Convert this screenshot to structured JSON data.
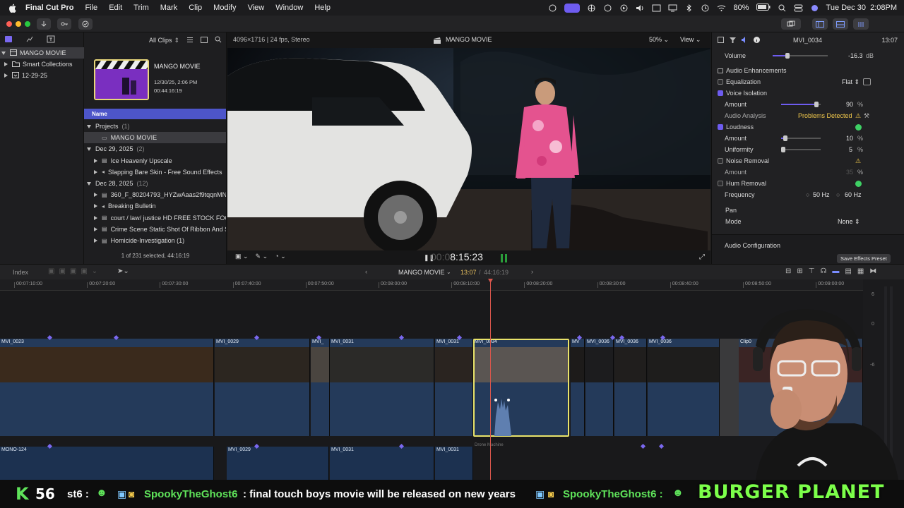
{
  "menubar": {
    "app_name": "Final Cut Pro",
    "items": [
      "File",
      "Edit",
      "Trim",
      "Mark",
      "Clip",
      "Modify",
      "View",
      "Window",
      "Help"
    ],
    "battery": "80%",
    "datetime": "Tue Dec 30  2:08PM"
  },
  "library": {
    "name": "MANGO MOVIE",
    "items": [
      "Smart Collections",
      "12-29-25"
    ]
  },
  "browser": {
    "filter": "All Clips",
    "project_card": {
      "title": "MANGO MOVIE",
      "date": "12/30/25, 2:06 PM",
      "duration": "00:44:16:19"
    },
    "column_header": "Name",
    "rows": [
      {
        "label": "Projects",
        "count": "(1)",
        "level": 0,
        "kind": "group"
      },
      {
        "label": "MANGO MOVIE",
        "level": 1,
        "kind": "project",
        "selected": true
      },
      {
        "label": "Dec 29, 2025",
        "count": "(2)",
        "level": 0,
        "kind": "group"
      },
      {
        "label": "Ice Heavenly Upscale",
        "level": 1,
        "kind": "video"
      },
      {
        "label": "Slapping Bare Skin - Free Sound Effects",
        "level": 1,
        "kind": "audio"
      },
      {
        "label": "Dec 28, 2025",
        "count": "(12)",
        "level": 0,
        "kind": "group"
      },
      {
        "label": "360_F_80204793_HYZwAaas2f9tqqnMN",
        "level": 1,
        "kind": "video"
      },
      {
        "label": "Breaking Bulletin",
        "level": 1,
        "kind": "audio"
      },
      {
        "label": "court / law/ justice HD FREE STOCK FOO",
        "level": 1,
        "kind": "video"
      },
      {
        "label": "Crime Scene Static Shot Of Ribbon And S",
        "level": 1,
        "kind": "video"
      },
      {
        "label": "Homicide-Investigation (1)",
        "level": 1,
        "kind": "video"
      }
    ],
    "status": "1 of 231 selected, 44:16:19"
  },
  "viewer": {
    "format": "4096×1716 | 24 fps, Stereo",
    "title": "MANGO MOVIE",
    "zoom": "50%",
    "view_label": "View",
    "timecode_dim": "00:0",
    "timecode": "8:15:23"
  },
  "inspector": {
    "clip_name": "MVI_0034",
    "duration": "13:07",
    "volume_label": "Volume",
    "volume_value": "-16.3",
    "volume_unit": "dB",
    "section": "Audio Enhancements",
    "equalization": {
      "label": "Equalization",
      "value": "Flat"
    },
    "voice_isolation": {
      "label": "Voice Isolation",
      "checked": true,
      "amount_label": "Amount",
      "amount": "90",
      "unit": "%",
      "level": 0.9
    },
    "analysis": {
      "label": "Audio Analysis",
      "value": "Problems Detected"
    },
    "loudness": {
      "label": "Loudness",
      "checked": true,
      "amount_label": "Amount",
      "amount": "10",
      "unit": "%",
      "amount_level": 0.1,
      "uniformity_label": "Uniformity",
      "uniformity": "5",
      "uniformity_level": 0.05
    },
    "noise_removal": {
      "label": "Noise Removal",
      "checked": false,
      "amount_label": "Amount",
      "amount": "35",
      "unit": "%"
    },
    "hum_removal": {
      "label": "Hum Removal",
      "checked": false,
      "frequency_label": "Frequency",
      "opt1": "50 Hz",
      "opt2": "60 Hz"
    },
    "pan": {
      "label": "Pan",
      "mode_label": "Mode",
      "mode_value": "None"
    },
    "footer": "Audio Configuration",
    "save_button": "Save Effects Preset"
  },
  "timeline": {
    "index_label": "Index",
    "project": "MANGO MOVIE",
    "position": "13:07",
    "total": "44:16:19",
    "ruler": [
      "00:07:10:00",
      "00:07:20:00",
      "00:07:30:00",
      "00:07:40:00",
      "00:07:50:00",
      "00:08:00:00",
      "00:08:10:00",
      "00:08:20:00",
      "00:08:30:00",
      "00:08:40:00",
      "00:08:50:00",
      "00:09:00:00"
    ],
    "meter_labels": [
      "6",
      "0",
      "-6"
    ],
    "clips": [
      "MVI_0023",
      "MVI_0029",
      "MVI_",
      "MVI_0031",
      "MVI_0031",
      "MVI_0034",
      "MV",
      "MVI_0036",
      "MVI_0036",
      "MVI_0036",
      "Clip0"
    ],
    "lower_clips": [
      "MONO-124",
      "MVI_0029",
      "MVI_0031",
      "MVI_0031"
    ],
    "lower_label": "Drone Machine"
  },
  "ticker": {
    "count": "56",
    "chat1_tail": "st6 :",
    "chat2_user": "SpookyTheGhost6",
    "chat2_msg": ": final touch boys movie will be released on new years",
    "chat3_user": "SpookyTheGhost6 :",
    "banner": "BURGER PLANET"
  },
  "colors": {
    "accent": "#6e5cf0",
    "selection": "#e9e36a",
    "warning": "#f2c94c",
    "ok": "#3ed064",
    "chat_green": "#5fe35a"
  }
}
